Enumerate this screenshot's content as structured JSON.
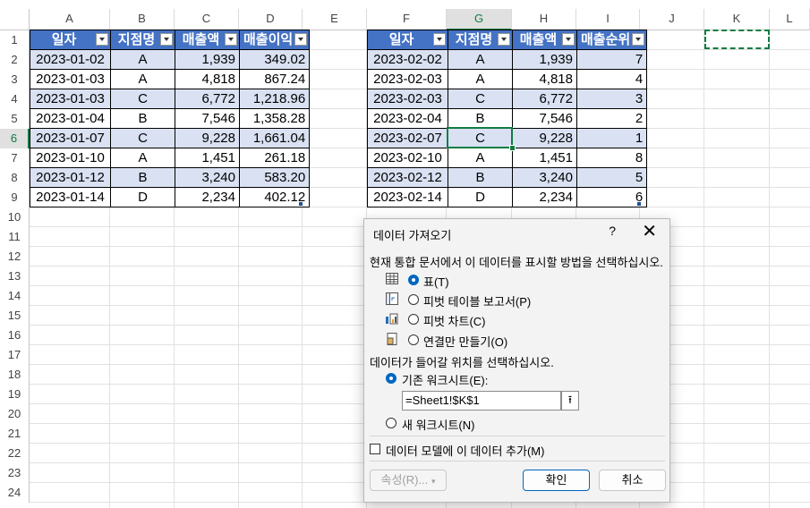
{
  "columns": [
    "A",
    "B",
    "C",
    "D",
    "E",
    "F",
    "G",
    "H",
    "I",
    "J",
    "K",
    "L"
  ],
  "rows": [
    "1",
    "2",
    "3",
    "4",
    "5",
    "6",
    "7",
    "8",
    "9",
    "10",
    "11",
    "12",
    "13",
    "14",
    "15",
    "16",
    "17",
    "18",
    "19",
    "20",
    "21",
    "22",
    "23",
    "24"
  ],
  "table1": {
    "headers": [
      "일자",
      "지점명",
      "매출액",
      "매출이익"
    ],
    "rows": [
      [
        "2023-01-02",
        "A",
        "1,939",
        "349.02"
      ],
      [
        "2023-01-03",
        "A",
        "4,818",
        "867.24"
      ],
      [
        "2023-01-03",
        "C",
        "6,772",
        "1,218.96"
      ],
      [
        "2023-01-04",
        "B",
        "7,546",
        "1,358.28"
      ],
      [
        "2023-01-07",
        "C",
        "9,228",
        "1,661.04"
      ],
      [
        "2023-01-10",
        "A",
        "1,451",
        "261.18"
      ],
      [
        "2023-01-12",
        "B",
        "3,240",
        "583.20"
      ],
      [
        "2023-01-14",
        "D",
        "2,234",
        "402.12"
      ]
    ]
  },
  "table2": {
    "headers": [
      "일자",
      "지점명",
      "매출액",
      "매출순위"
    ],
    "rows": [
      [
        "2023-02-02",
        "A",
        "1,939",
        "7"
      ],
      [
        "2023-02-03",
        "A",
        "4,818",
        "4"
      ],
      [
        "2023-02-03",
        "C",
        "6,772",
        "3"
      ],
      [
        "2023-02-04",
        "B",
        "7,546",
        "2"
      ],
      [
        "2023-02-07",
        "C",
        "9,228",
        "1"
      ],
      [
        "2023-02-10",
        "A",
        "1,451",
        "8"
      ],
      [
        "2023-02-12",
        "B",
        "3,240",
        "5"
      ],
      [
        "2023-02-14",
        "D",
        "2,234",
        "6"
      ]
    ]
  },
  "dialog": {
    "title": "데이터 가져오기",
    "help": "?",
    "close": "✕",
    "prompt1": "현재 통합 문서에서 이 데이터를 표시할 방법을 선택하십시오.",
    "opt_table": "표(T)",
    "opt_pivot_table": "피벗 테이블 보고서(P)",
    "opt_pivot_chart": "피벗 차트(C)",
    "opt_connection": "연결만 만들기(O)",
    "prompt2": "데이터가 들어갈 위치를 선택하십시오.",
    "opt_existing": "기존 워크시트(E):",
    "location_value": "=Sheet1!$K$1",
    "opt_new": "새 워크시트(N)",
    "add_model": "데이터 모델에 이 데이터 추가(M)",
    "properties": "속성(R)...",
    "ok": "확인",
    "cancel": "취소"
  }
}
